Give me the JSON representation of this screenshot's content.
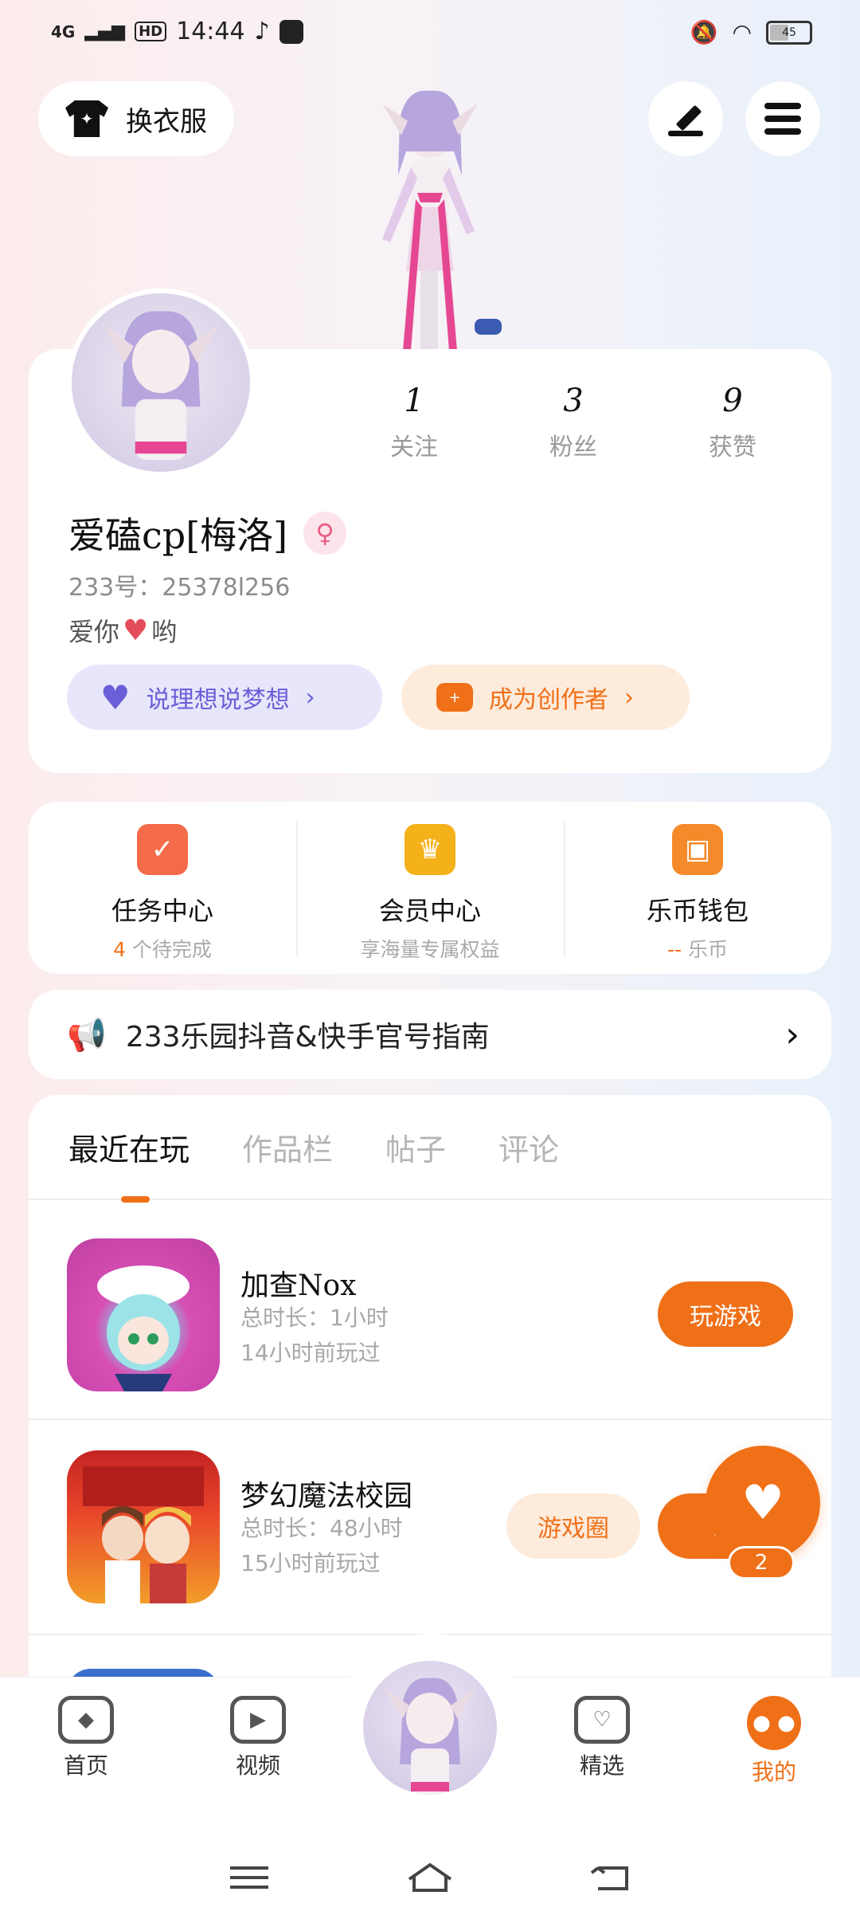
{
  "status_bar": {
    "network": "4G",
    "hd": "HD",
    "time": "14:44",
    "battery": "45"
  },
  "top": {
    "outfit_label": "换衣服",
    "outfit_icon": "shirt-star-icon",
    "edit_icon": "pen-icon",
    "menu_icon": "hamburger-menu-icon"
  },
  "profile": {
    "stats": [
      {
        "value": "1",
        "label": "关注"
      },
      {
        "value": "3",
        "label": "粉丝"
      },
      {
        "value": "9",
        "label": "获赞"
      }
    ],
    "username": "爱磕cp[梅洛]",
    "gender_icon": "♀",
    "uid": "233号：25378l256",
    "bio_prefix": "爱你",
    "bio_suffix": "哟",
    "btn_left": "说理想说梦想",
    "btn_right": "成为创作者"
  },
  "quick_actions": [
    {
      "title": "任务中心",
      "sub_highlight": "4",
      "sub": "个待完成",
      "color": "#f46b4a",
      "icon": "calendar-check-icon"
    },
    {
      "title": "会员中心",
      "sub_highlight": "",
      "sub": "享海量专属权益",
      "color": "#f5b11a",
      "icon": "crown-icon"
    },
    {
      "title": "乐币钱包",
      "sub_highlight": "--",
      "sub": "乐币",
      "color": "#f58a2a",
      "icon": "wallet-icon"
    }
  ],
  "announcement": {
    "text": "233乐园抖音&快手官号指南"
  },
  "tabs": [
    "最近在玩",
    "作品栏",
    "帖子",
    "评论"
  ],
  "games": [
    {
      "name": "加查Nox",
      "duration": "总时长：1小时",
      "last": "14小时前玩过",
      "play": "玩游戏"
    },
    {
      "name": "梦幻魔法校园",
      "duration": "总时长：48小时",
      "last": "15小时前玩过",
      "circle": "游戏圈",
      "play": "玩"
    }
  ],
  "fab": {
    "count": "2"
  },
  "bottom_nav": [
    {
      "label": "首页",
      "icon": "gamepad-icon"
    },
    {
      "label": "视频",
      "icon": "play-icon"
    },
    {
      "label": "精选",
      "icon": "heart-badge-icon"
    },
    {
      "label": "我的",
      "icon": "me-icon"
    }
  ],
  "colors": {
    "accent": "#f07018",
    "purple": "#6a5fd8"
  }
}
